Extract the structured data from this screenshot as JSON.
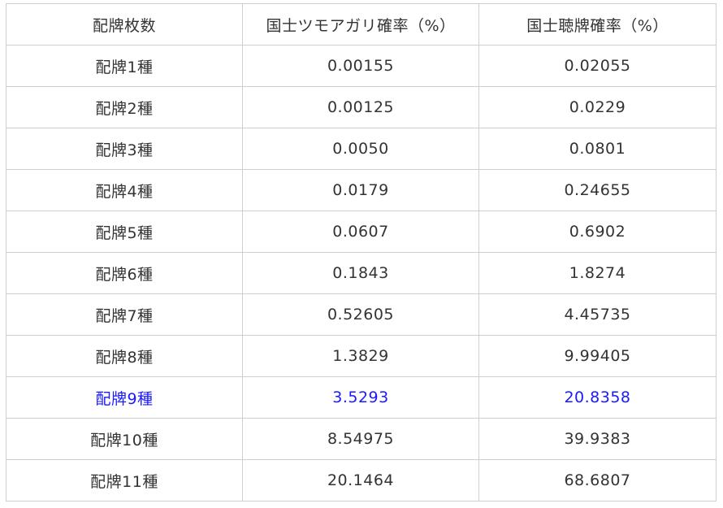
{
  "table": {
    "headers": [
      "配牌枚数",
      "国士ツモアガリ確率（%）",
      "国士聴牌確率（%）"
    ],
    "rows": [
      [
        "配牌1種",
        "0.00155",
        "0.02055"
      ],
      [
        "配牌2種",
        "0.00125",
        "0.0229"
      ],
      [
        "配牌3種",
        "0.0050",
        "0.0801"
      ],
      [
        "配牌4種",
        "0.0179",
        "0.24655"
      ],
      [
        "配牌5種",
        "0.0607",
        "0.6902"
      ],
      [
        "配牌6種",
        "0.1843",
        "1.8274"
      ],
      [
        "配牌7種",
        "0.52605",
        "4.45735"
      ],
      [
        "配牌8種",
        "1.3829",
        "9.99405"
      ],
      [
        "配牌9種",
        "3.5293",
        "20.8358"
      ],
      [
        "配牌10種",
        "8.54975",
        "39.9383"
      ],
      [
        "配牌11種",
        "20.1464",
        "68.6807"
      ]
    ],
    "highlight_row_index": 8
  },
  "colors": {
    "text": "#333333",
    "highlight": "#1a1aff",
    "border": "#cfcfcf"
  }
}
